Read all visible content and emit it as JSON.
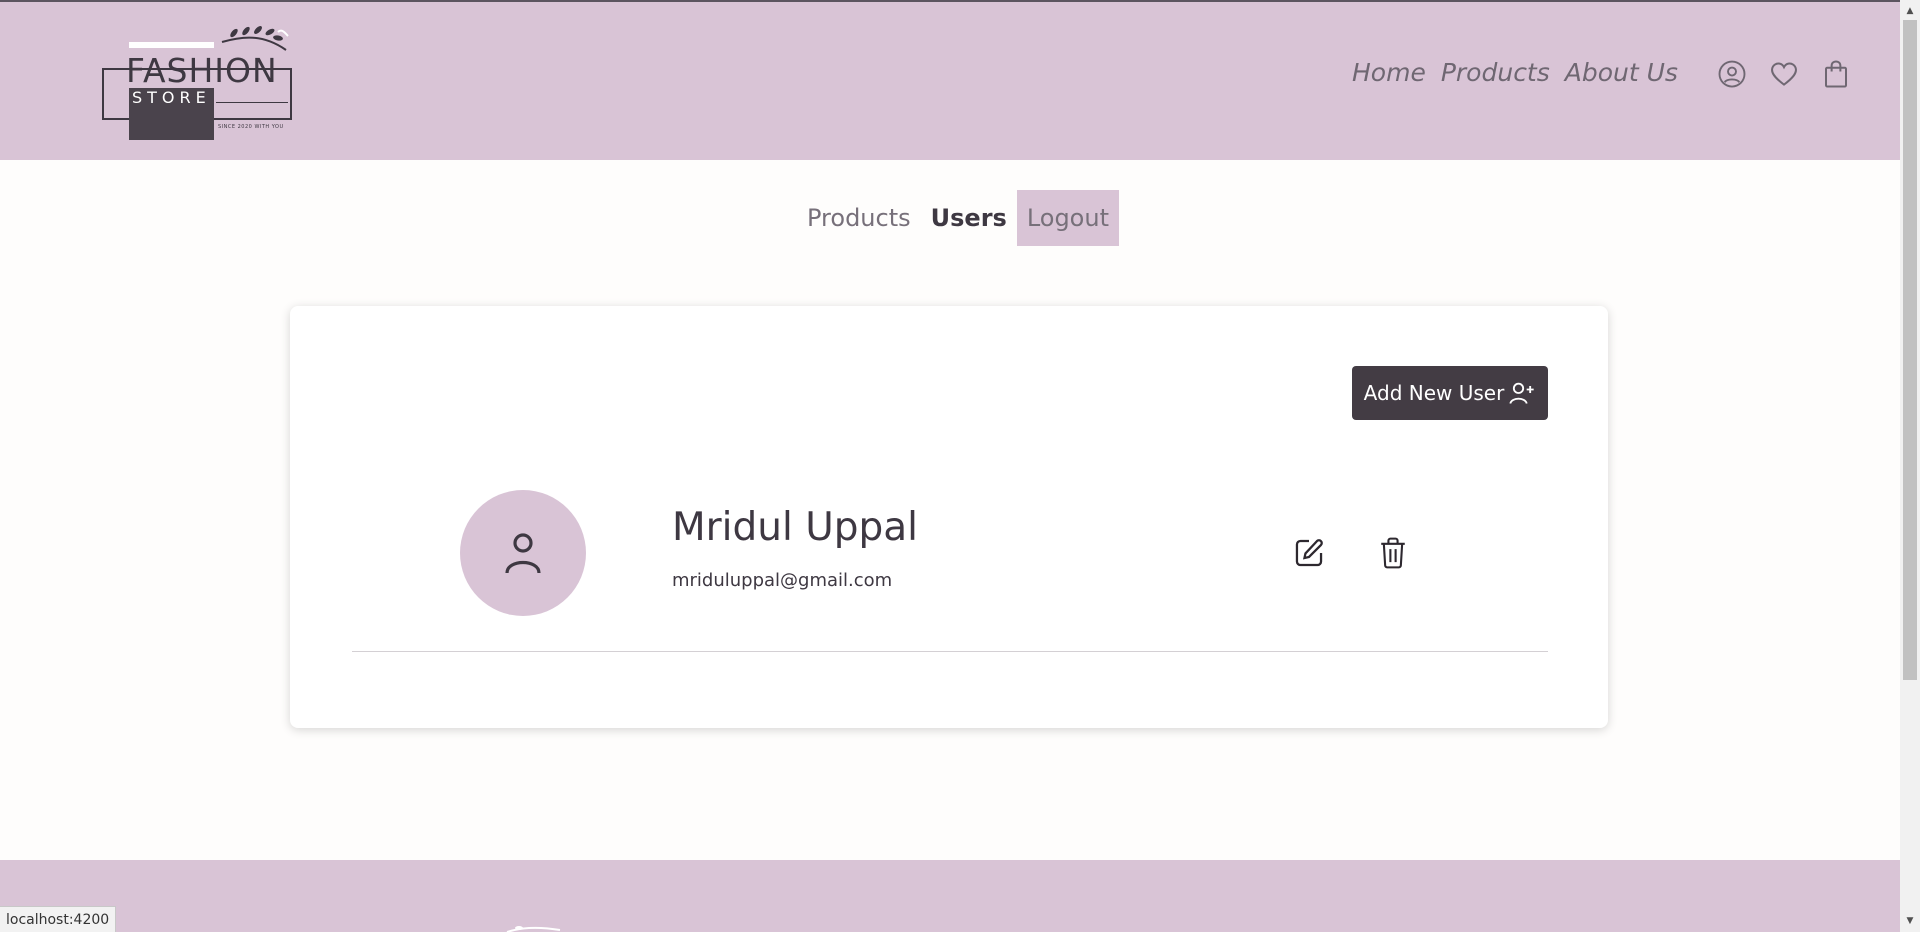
{
  "logo": {
    "brand_line1": "FASHION",
    "brand_line2": "STORE",
    "tagline": "SINCE 2020 WITH YOU"
  },
  "nav": {
    "items": [
      {
        "label": "Home"
      },
      {
        "label": "Products"
      },
      {
        "label": "About Us"
      }
    ]
  },
  "header_icons": [
    "user-icon",
    "heart-icon",
    "shopping-bag-icon"
  ],
  "tabs": [
    {
      "label": "Products",
      "state": "normal"
    },
    {
      "label": "Users",
      "state": "active"
    },
    {
      "label": "Logout",
      "state": "highlight"
    }
  ],
  "card": {
    "add_user_label": "Add New User",
    "users": [
      {
        "name": "Mridul Uppal",
        "email": "mriduluppal@gmail.com"
      }
    ]
  },
  "status_bar": {
    "url": "localhost:4200"
  },
  "colors": {
    "accent": "#d9c4d6",
    "dark": "#433c44",
    "text": "#3e3842",
    "muted": "#77707a"
  }
}
